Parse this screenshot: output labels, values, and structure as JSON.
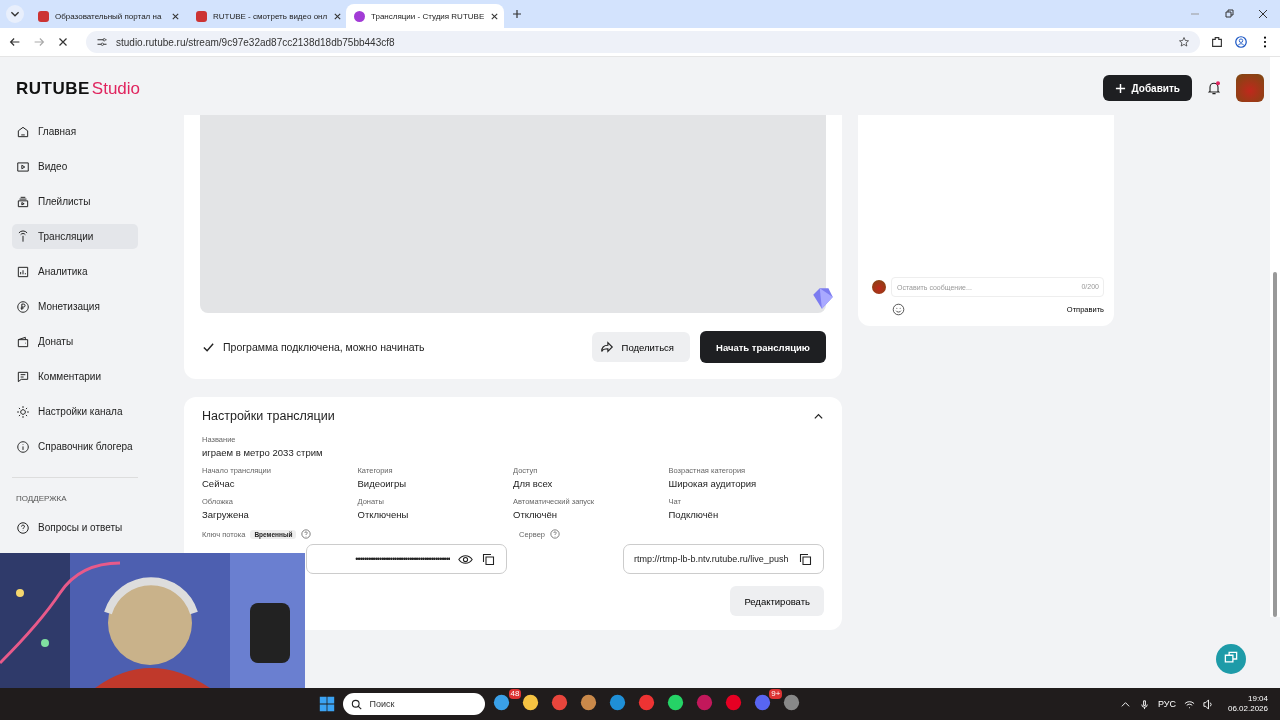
{
  "browser": {
    "tabs": [
      {
        "title": "Образовательный портал на",
        "selected": false
      },
      {
        "title": "RUTUBE - смотреть видео онл",
        "selected": false
      },
      {
        "title": "Трансляции - Студия RUTUBE",
        "selected": true
      }
    ],
    "url": "studio.rutube.ru/stream/9c97e32ad87cc2138d18db75bb443cf8"
  },
  "header": {
    "logo": "RUTUBE",
    "logo_suffix": "Studio",
    "add_button": "Добавить",
    "notification": true
  },
  "sidebar": {
    "items": [
      {
        "label": "Главная",
        "selected": false
      },
      {
        "label": "Видео",
        "selected": false
      },
      {
        "label": "Плейлисты",
        "selected": false
      },
      {
        "label": "Трансляции",
        "selected": true
      },
      {
        "label": "Аналитика",
        "selected": false
      },
      {
        "label": "Монетизация",
        "selected": false
      },
      {
        "label": "Донаты",
        "selected": false
      },
      {
        "label": "Комментарии",
        "selected": false
      },
      {
        "label": "Настройки канала",
        "selected": false
      },
      {
        "label": "Справочник блогера",
        "selected": false
      }
    ],
    "support_heading": "ПОДДЕРЖКА",
    "support_items": [
      {
        "label": "Вопросы и ответы",
        "selected": false
      }
    ]
  },
  "player": {
    "status": "Программа подключена, можно начинать",
    "share_button": "Поделиться",
    "start_button": "Начать трансляцию"
  },
  "settings": {
    "title": "Настройки трансляции",
    "expanded": true,
    "name": {
      "label": "Название",
      "value": "играем в метро 2033 стрим"
    },
    "fields": [
      {
        "label": "Начало трансляции",
        "value": "Сейчас"
      },
      {
        "label": "Категория",
        "value": "Видеоигры"
      },
      {
        "label": "Доступ",
        "value": "Для всех"
      },
      {
        "label": "Возрастная категория",
        "value": "Широкая аудитория"
      },
      {
        "label": "Обложка",
        "value": "Загружена"
      },
      {
        "label": "Донаты",
        "value": "Отключены"
      },
      {
        "label": "Автоматический запуск",
        "value": "Отключён"
      },
      {
        "label": "Чат",
        "value": "Подключён"
      }
    ],
    "stream_key": {
      "label": "Ключ потока",
      "badge": "Временный",
      "value": "••••••••••••••••••••••••••••••••••••••••••••"
    },
    "server": {
      "label": "Сервер",
      "value": "rtmp://rtmp-lb-b.ntv.rutube.ru/live_push"
    },
    "edit_button": "Редактировать"
  },
  "chat": {
    "placeholder": "Оставить сообщение...",
    "counter": "0/200",
    "send_button": "Отправить"
  },
  "taskbar": {
    "search_placeholder": "Поиск",
    "badges": [
      "48",
      "9+"
    ],
    "language": "РУС",
    "time": "19:04",
    "date": "06.02.2026"
  }
}
